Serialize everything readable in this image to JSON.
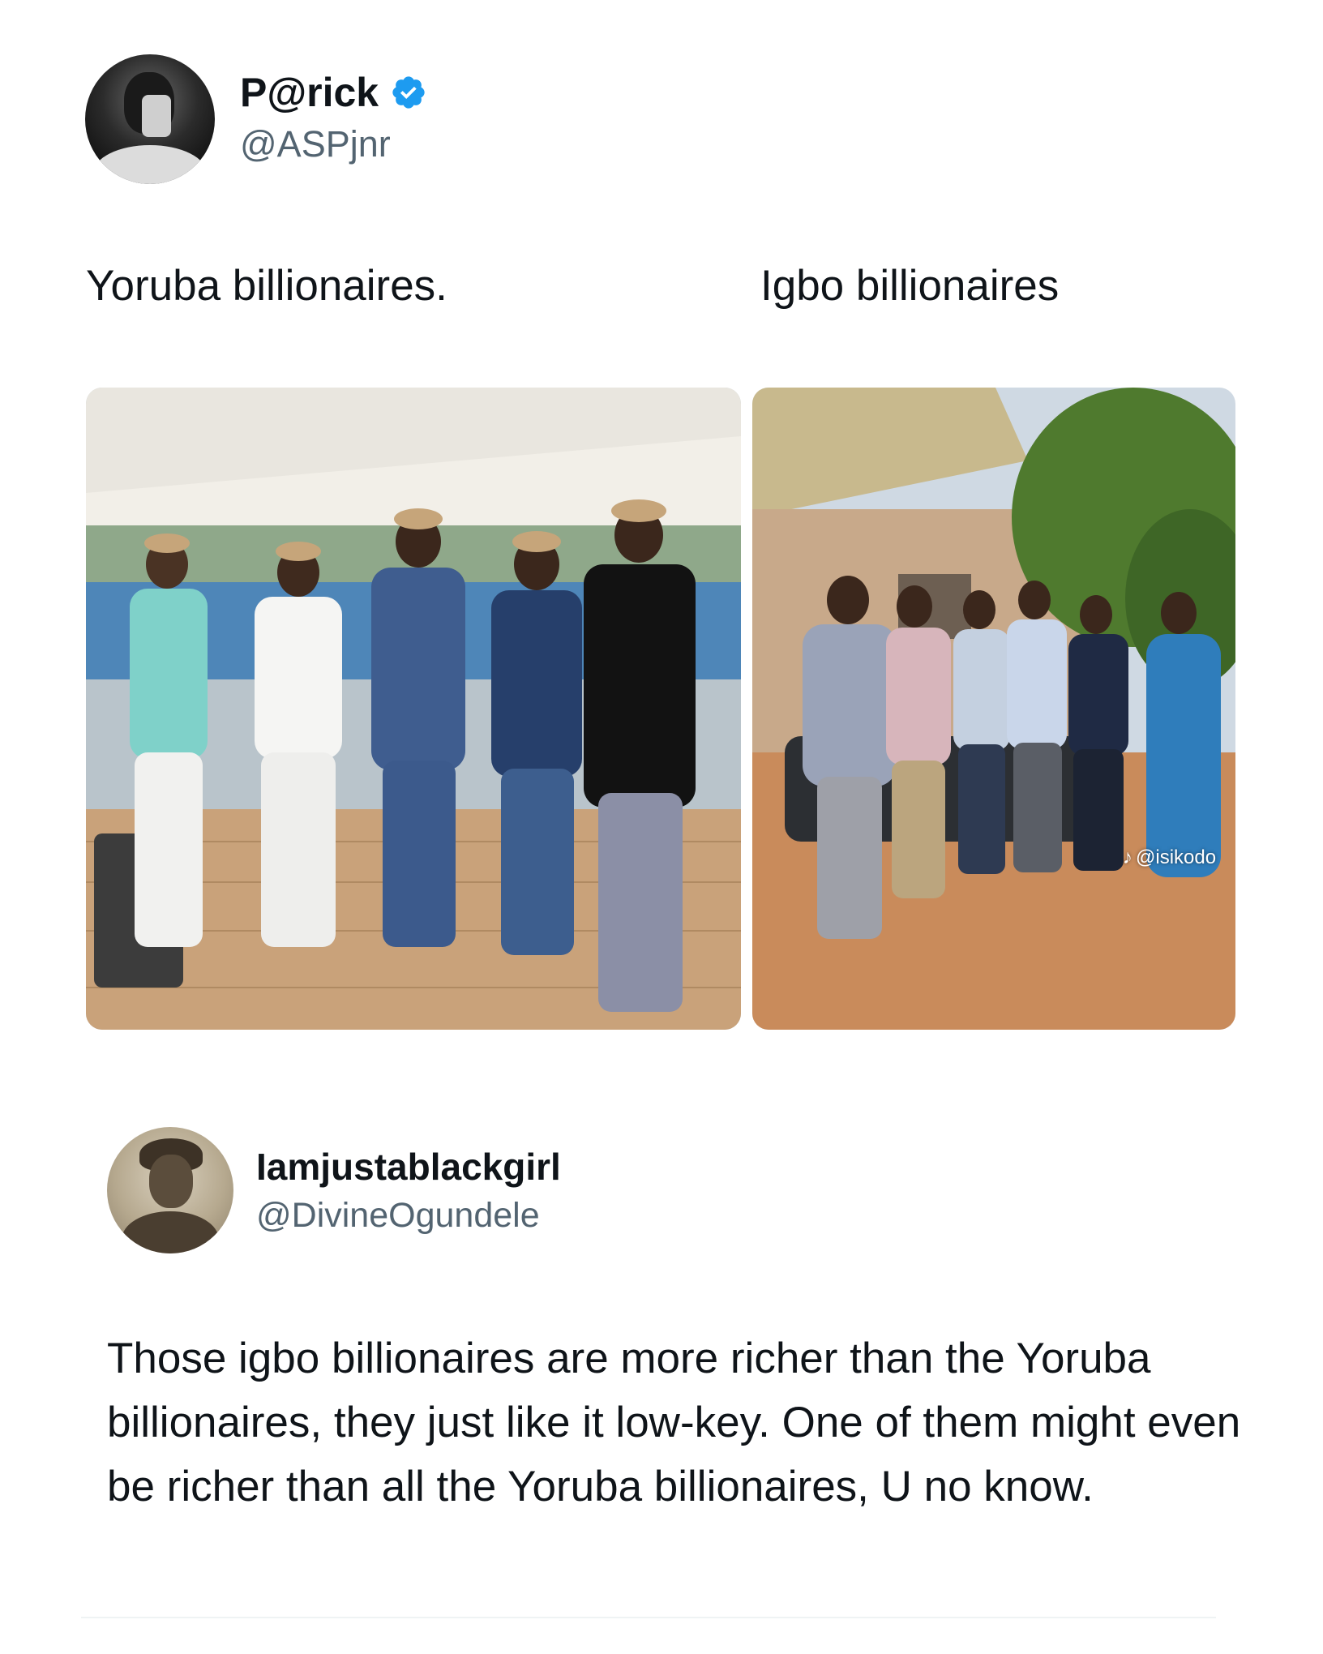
{
  "tweet": {
    "author_name": "P@rick",
    "author_handle": "@ASPjnr",
    "verified": true,
    "caption_left": "Yoruba billionaires.",
    "caption_right": "Igbo billionaires",
    "watermark": "@isikodo",
    "accent_color": "#1d9bf0"
  },
  "reply": {
    "author_name": "Iamjustablackgirl",
    "author_handle": "@DivineOgundele",
    "text": "Those igbo billionaires are more richer than the Yoruba billionaires, they just like it low-key. One of them might even be richer than all the Yoruba billionaires, U no know."
  }
}
